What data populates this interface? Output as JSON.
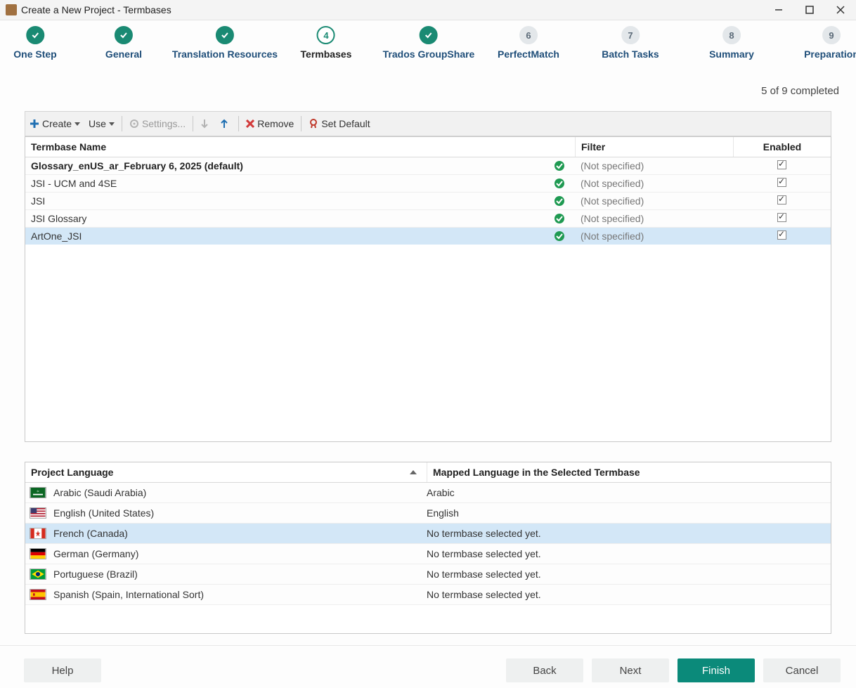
{
  "window": {
    "title": "Create a New Project - Termbases"
  },
  "steps": {
    "completed_text": "5 of 9 completed",
    "items": [
      {
        "label": "One Step",
        "state": "done"
      },
      {
        "label": "General",
        "state": "done"
      },
      {
        "label": "Translation Resources",
        "state": "done"
      },
      {
        "label": "Termbases",
        "state": "current",
        "num": "4"
      },
      {
        "label": "Trados GroupShare",
        "state": "done"
      },
      {
        "label": "PerfectMatch",
        "state": "pending",
        "num": "6"
      },
      {
        "label": "Batch Tasks",
        "state": "pending",
        "num": "7"
      },
      {
        "label": "Summary",
        "state": "pending",
        "num": "8"
      },
      {
        "label": "Preparation",
        "state": "pending",
        "num": "9"
      }
    ]
  },
  "toolbar": {
    "create": "Create",
    "use": "Use",
    "settings": "Settings...",
    "remove": "Remove",
    "set_default": "Set Default"
  },
  "termbase_grid": {
    "headers": {
      "name": "Termbase Name",
      "filter": "Filter",
      "enabled": "Enabled"
    },
    "rows": [
      {
        "name": "Glossary_enUS_ar_February 6, 2025 (default)",
        "bold": true,
        "filter": "(Not specified)",
        "enabled": true
      },
      {
        "name": "JSI - UCM and 4SE",
        "filter": "(Not specified)",
        "enabled": true
      },
      {
        "name": "JSI",
        "filter": "(Not specified)",
        "enabled": true
      },
      {
        "name": "JSI Glossary",
        "filter": "(Not specified)",
        "enabled": true
      },
      {
        "name": "ArtOne_JSI",
        "filter": "(Not specified)",
        "enabled": true,
        "selected": true
      }
    ]
  },
  "language_grid": {
    "headers": {
      "project": "Project Language",
      "mapped": "Mapped Language in the Selected Termbase"
    },
    "rows": [
      {
        "lang": "Arabic (Saudi Arabia)",
        "mapped": "Arabic",
        "flag": "sa"
      },
      {
        "lang": "English (United States)",
        "mapped": "English",
        "flag": "us"
      },
      {
        "lang": "French (Canada)",
        "mapped": "No termbase selected yet.",
        "flag": "ca",
        "selected": true
      },
      {
        "lang": "German (Germany)",
        "mapped": "No termbase selected yet.",
        "flag": "de"
      },
      {
        "lang": "Portuguese (Brazil)",
        "mapped": "No termbase selected yet.",
        "flag": "br"
      },
      {
        "lang": "Spanish (Spain, International Sort)",
        "mapped": "No termbase selected yet.",
        "flag": "es"
      }
    ]
  },
  "footer": {
    "help": "Help",
    "back": "Back",
    "next": "Next",
    "finish": "Finish",
    "cancel": "Cancel"
  }
}
